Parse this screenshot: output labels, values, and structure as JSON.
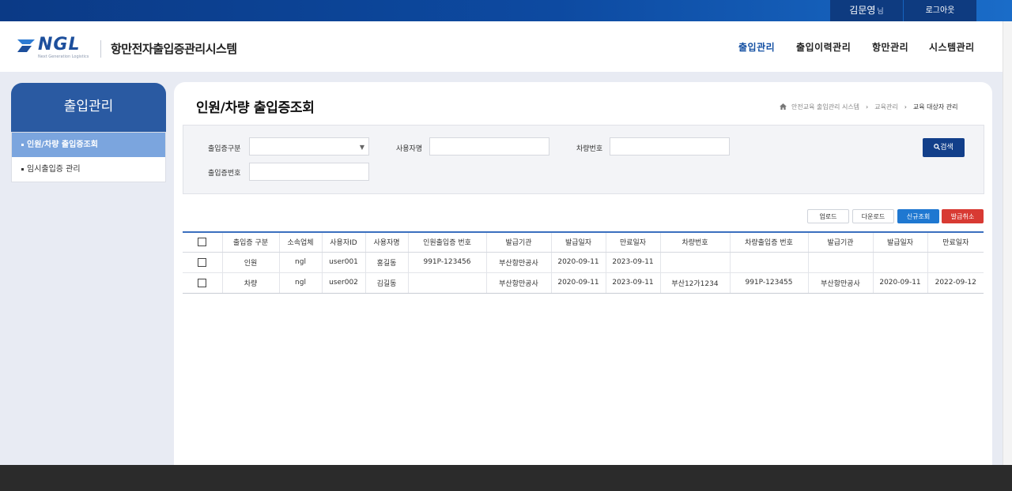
{
  "top": {
    "user_name": "김문영",
    "user_suffix": "님",
    "logout_label": "로그아웃"
  },
  "header": {
    "logo_text": "NGL",
    "logo_sub": "Next Generation Logistics",
    "app_title": "항만전자출입증관리시스템",
    "nav": [
      "출입관리",
      "출입이력관리",
      "항만관리",
      "시스템관리"
    ]
  },
  "sidebar": {
    "title": "출입관리",
    "items": [
      {
        "label": "인원/차량 출입증조회"
      },
      {
        "label": "임시출입증 관리"
      }
    ]
  },
  "page": {
    "title": "인원/차량 출입증조회",
    "breadcrumb": [
      "안전교육 출입관리 시스템",
      "교육관리",
      "교육 대상자 관리"
    ]
  },
  "search": {
    "fields": {
      "pass_type_label": "출입증구분",
      "pass_type_value": "",
      "user_name_label": "사용자명",
      "vehicle_no_label": "차량번호",
      "pass_no_label": "출입증번호"
    },
    "button_label": "검색"
  },
  "actions": {
    "upload": "업로드",
    "download": "다운로드",
    "new": "신규조회",
    "cancel": "발급취소"
  },
  "table": {
    "columns": [
      "출입증 구분",
      "소속업체",
      "사용자ID",
      "사용자명",
      "인원출입증 번호",
      "발급기관",
      "발급일자",
      "만료일자",
      "차량번호",
      "차량출입증 번호",
      "발급기관",
      "발급일자",
      "만료일자"
    ],
    "rows": [
      [
        "인원",
        "ngl",
        "user001",
        "홍길동",
        "991P-123456",
        "부산항만공사",
        "2020-09-11",
        "2023-09-11",
        "",
        "",
        "",
        "",
        ""
      ],
      [
        "차량",
        "ngl",
        "user002",
        "김길동",
        "",
        "부산항만공사",
        "2020-09-11",
        "2023-09-11",
        "부산12가1234",
        "991P-123455",
        "부산항만공사",
        "2020-09-11",
        "2022-09-12"
      ]
    ]
  },
  "colors": {
    "topbar": "#0d4aa1",
    "sidebar_head": "#2a5aa2",
    "sidebar_active": "#7ba5de",
    "search_button": "#123f8a",
    "new_button": "#1f78d1",
    "cancel_button": "#d83a33",
    "footer": "#2b2b2b"
  }
}
